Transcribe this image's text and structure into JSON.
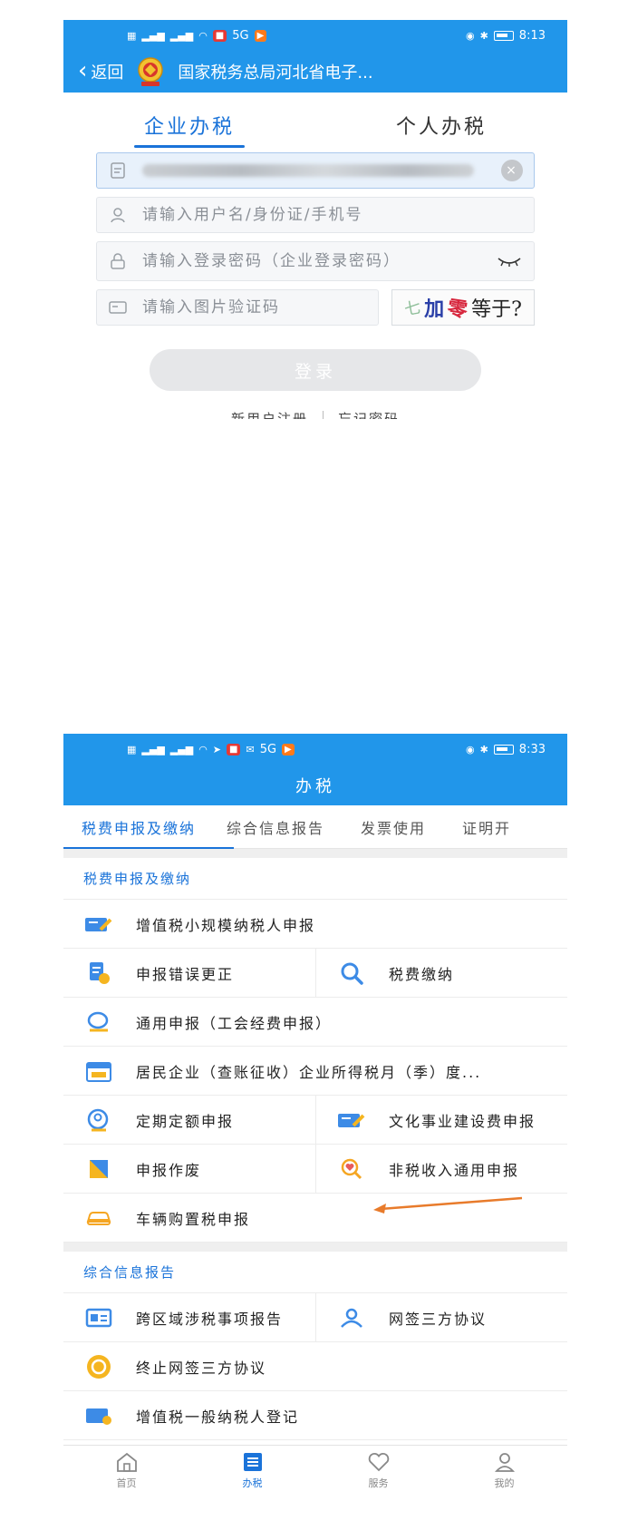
{
  "phone1": {
    "status": {
      "network": "5G",
      "time": "8:13"
    },
    "nav": {
      "back_label": "返回",
      "title": "国家税务总局河北省电子..."
    },
    "tabs": [
      {
        "label": "企业办税",
        "active": true
      },
      {
        "label": "个人办税",
        "active": false
      }
    ],
    "form": {
      "username_placeholder": "请输入用户名/身份证/手机号",
      "password_placeholder": "请输入登录密码（企业登录密码）",
      "captcha_placeholder": "请输入图片验证码",
      "captcha_text": [
        "七",
        "加",
        "零",
        "等于?"
      ]
    },
    "login_label": "登录",
    "register_label": "新用户注册",
    "forgot_label": "忘记密码"
  },
  "phone2": {
    "status": {
      "network": "5G",
      "time": "8:33"
    },
    "nav_title": "办税",
    "tabs": [
      {
        "label": "税费申报及缴纳",
        "active": true
      },
      {
        "label": "综合信息报告",
        "active": false
      },
      {
        "label": "发票使用",
        "active": false
      },
      {
        "label": "证明开",
        "active": false
      }
    ],
    "section1": {
      "title": "税费申报及缴纳",
      "items": {
        "vat_small": "增值税小规模纳税人申报",
        "correction": "申报错误更正",
        "payment": "税费缴纳",
        "general": "通用申报（工会经费申报）",
        "resident": "居民企业（查账征收）企业所得税月（季）度...",
        "fixed": "定期定额申报",
        "culture": "文化事业建设费申报",
        "void": "申报作废",
        "nontax": "非税收入通用申报",
        "vehicle": "车辆购置税申报"
      }
    },
    "section2": {
      "title": "综合信息报告",
      "items": {
        "cross_region": "跨区域涉税事项报告",
        "tripartite": "网签三方协议",
        "terminate": "终止网签三方协议",
        "vat_general": "增值税一般纳税人登记"
      }
    },
    "bottom_nav": [
      {
        "label": "首页",
        "active": false
      },
      {
        "label": "办税",
        "active": true
      },
      {
        "label": "服务",
        "active": false
      },
      {
        "label": "我的",
        "active": false
      }
    ],
    "colors": {
      "primary": "#2196ea",
      "accent": "#1a73d9",
      "arrow": "#e87b2b"
    }
  }
}
